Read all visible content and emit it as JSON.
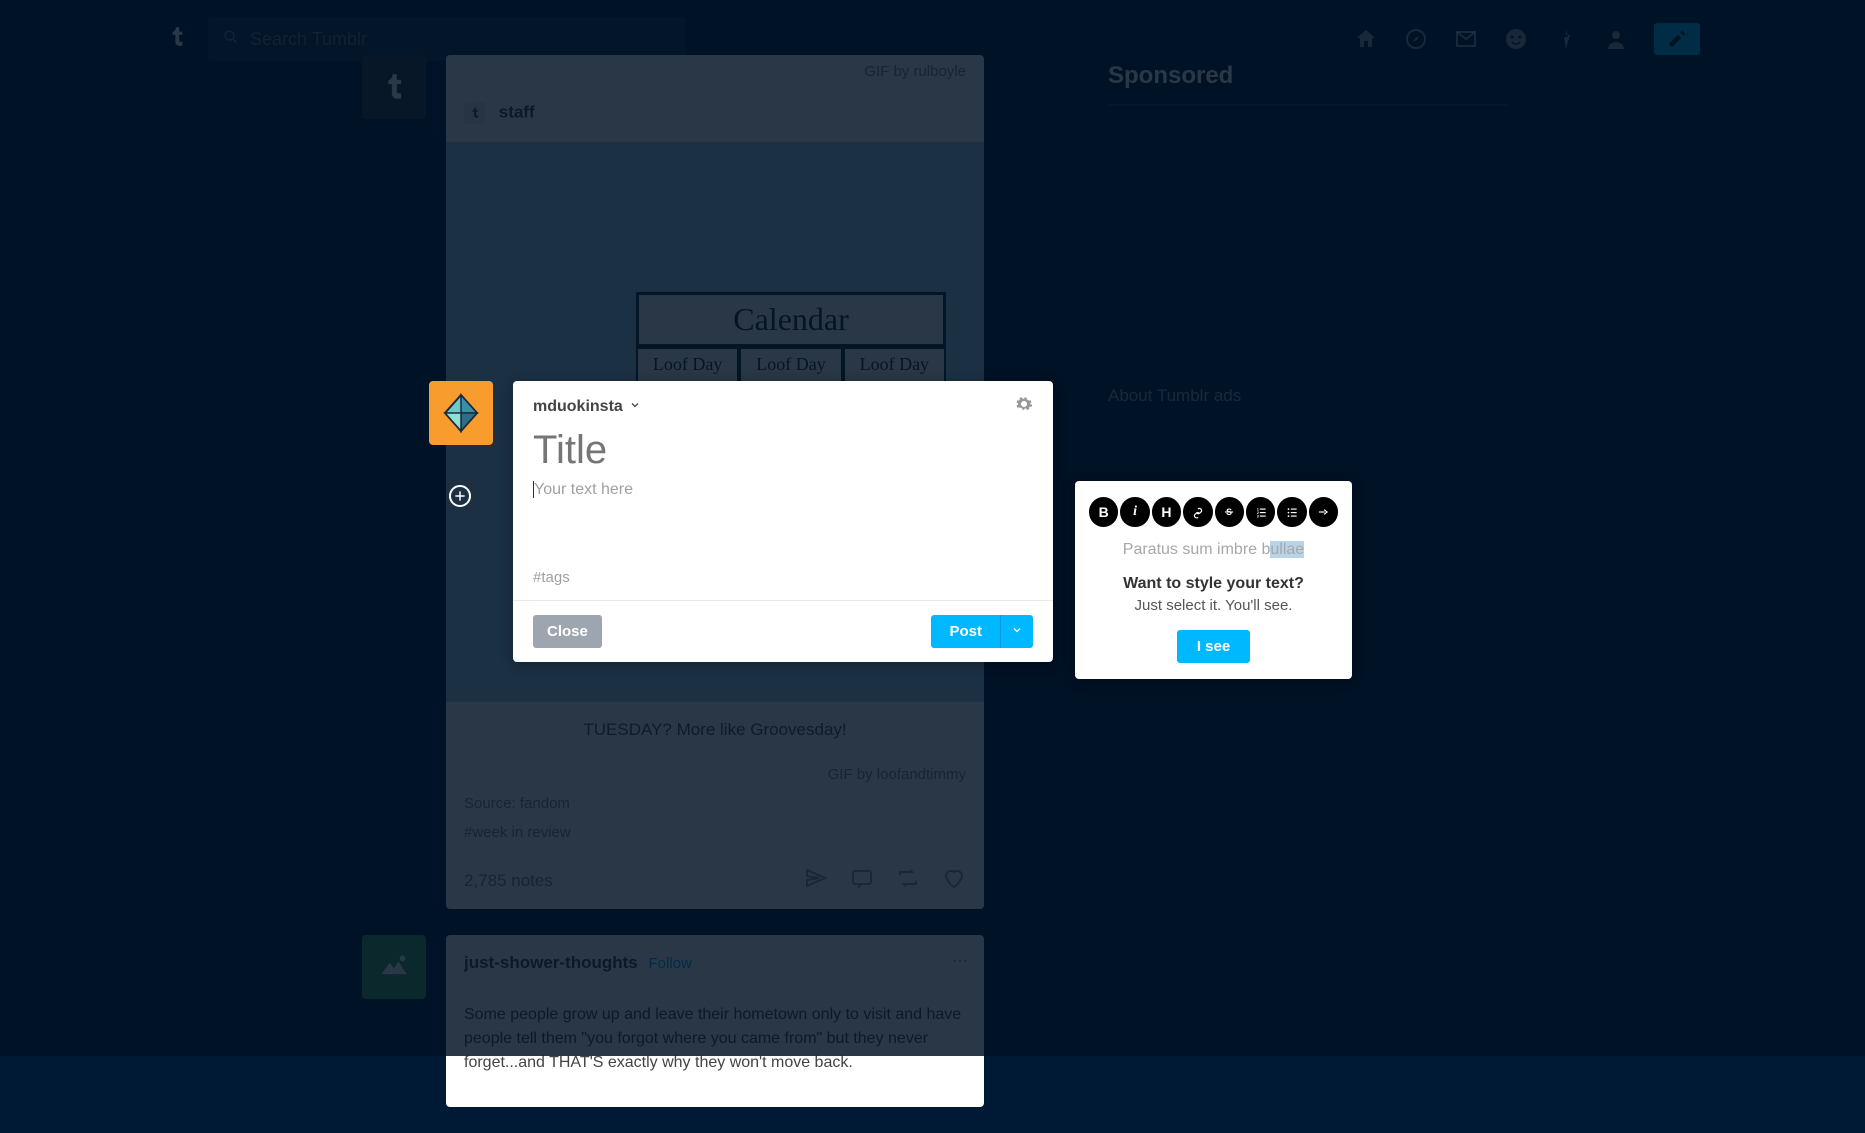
{
  "nav": {
    "search_placeholder": "Search Tumblr"
  },
  "sidebar": {
    "heading": "Sponsored",
    "about_link": "About Tumblr ads"
  },
  "posts": [
    {
      "gif_by_label": "GIF by",
      "gif_by_user_top": "rulboyle",
      "author": "staff",
      "calendar_title": "Calendar",
      "day_label": "Loof Day",
      "bubble": "?",
      "caption": "TUESDAY? More like Groovesday!",
      "gif_by_user_bottom": "loofandtimmy",
      "source_label": "Source:",
      "source_user": "fandom",
      "hashtag": "#week in review",
      "notes": "2,785 notes"
    },
    {
      "author": "just-shower-thoughts",
      "follow": "Follow",
      "body": "Some people grow up and leave their hometown only to visit and have people tell them \"you forgot where you came from\" but they never forget...and THAT'S exactly why they won't move back."
    }
  ],
  "compose": {
    "blog_name": "mduokinsta",
    "title_placeholder": "Title",
    "body_placeholder": "Your text here",
    "tags_placeholder": "#tags",
    "close_label": "Close",
    "post_label": "Post"
  },
  "tooltip": {
    "sample_prefix": "Paratus sum imbre b",
    "sample_highlight": "ullae",
    "heading": "Want to style your text?",
    "body": "Just select it. You'll see.",
    "button": "I see"
  },
  "fmt": {
    "bold": "B",
    "italic": "i",
    "heading": "H"
  }
}
